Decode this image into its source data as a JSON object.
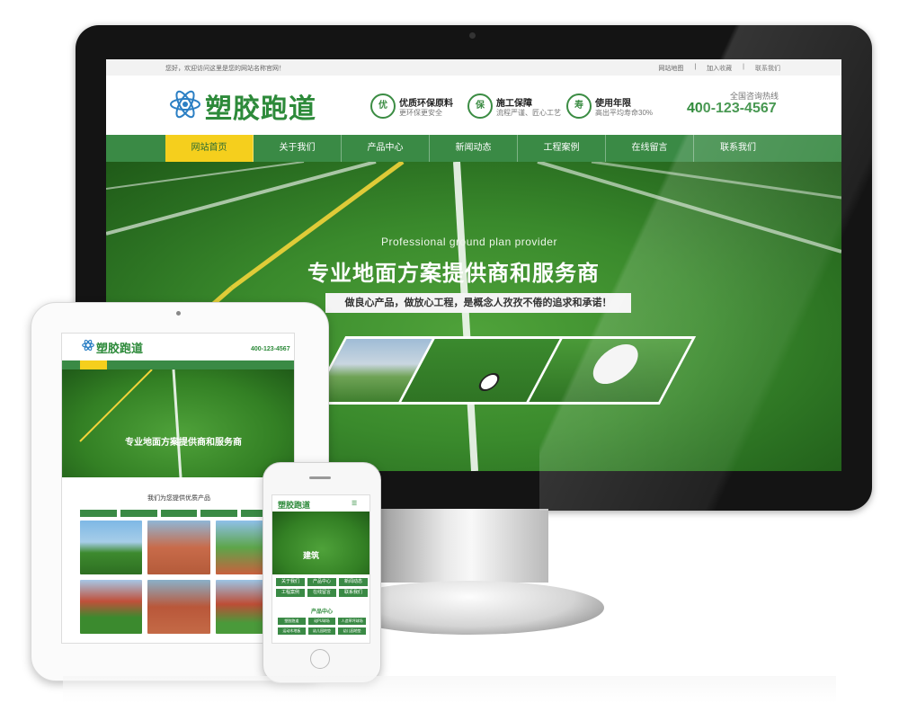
{
  "desktop": {
    "topbar": {
      "welcome": "您好，欢迎访问这里是您的网站名称官网！",
      "links": [
        "网站地图",
        "加入收藏",
        "联系我们"
      ]
    },
    "header": {
      "logo_text": "塑胶跑道",
      "features": [
        {
          "icon_char": "优",
          "title": "优质环保原料",
          "subtitle": "更环保更安全"
        },
        {
          "icon_char": "保",
          "title": "施工保障",
          "subtitle": "流程严谨、匠心工艺"
        },
        {
          "icon_char": "寿",
          "title": "使用年限",
          "subtitle": "高出平均寿命30%"
        }
      ],
      "hotline_label": "全国咨询热线",
      "hotline_number": "400-123-4567"
    },
    "nav": [
      "网站首页",
      "关于我们",
      "产品中心",
      "新闻动态",
      "工程案例",
      "在线留言",
      "联系我们"
    ],
    "banner": {
      "english": "Professional ground plan provider",
      "headline": "专业地面方案提供商和服务商",
      "subline": "做良心产品，做放心工程，是概念人孜孜不倦的追求和承诺！"
    }
  },
  "tablet": {
    "logo_text": "塑胶跑道",
    "hotline": "400-123-4567",
    "banner_headline": "专业地面方案提供商和服务商",
    "section_title": "我们为您提供优质产品"
  },
  "phone": {
    "logo_text": "塑胶跑道",
    "banner_headline": "建筑",
    "menu": [
      "关于我们",
      "产品中心",
      "新闻动态",
      "工程案例",
      "在线留言",
      "联系我们"
    ],
    "section_title": "产品中心",
    "products": [
      "塑胶跑道",
      "硅PU球场",
      "人造草坪球场",
      "运动木地板",
      "幼儿园地垫",
      "幼儿园地垫"
    ]
  },
  "colors": {
    "brand_green": "#3a8a45",
    "accent_yellow": "#f5cf1d",
    "logo_green": "#2d8a3a"
  }
}
